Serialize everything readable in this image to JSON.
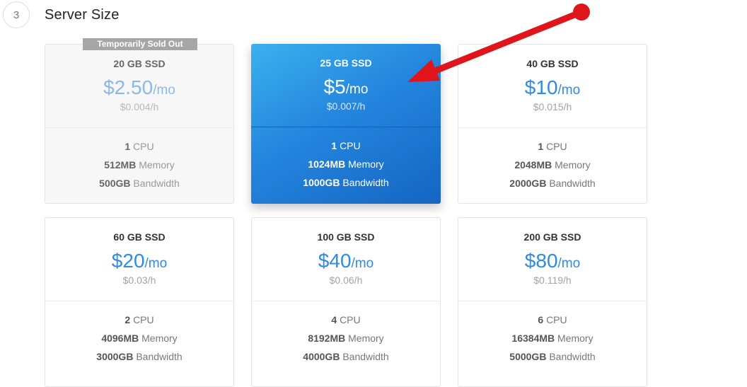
{
  "section": {
    "step": "3",
    "title": "Server Size"
  },
  "sold_badge": "Temporarily Sold Out",
  "plans": [
    {
      "name": "20 GB SSD",
      "price": "$2.50",
      "unit": "/mo",
      "hourly": "$0.004/h",
      "cpu": "1",
      "cpu_label": "CPU",
      "memory": "512MB",
      "memory_label": "Memory",
      "bandwidth": "500GB",
      "bandwidth_label": "Bandwidth",
      "sold_out": true
    },
    {
      "name": "25 GB SSD",
      "price": "$5",
      "unit": "/mo",
      "hourly": "$0.007/h",
      "cpu": "1",
      "cpu_label": "CPU",
      "memory": "1024MB",
      "memory_label": "Memory",
      "bandwidth": "1000GB",
      "bandwidth_label": "Bandwidth",
      "selected": true
    },
    {
      "name": "40 GB SSD",
      "price": "$10",
      "unit": "/mo",
      "hourly": "$0.015/h",
      "cpu": "1",
      "cpu_label": "CPU",
      "memory": "2048MB",
      "memory_label": "Memory",
      "bandwidth": "2000GB",
      "bandwidth_label": "Bandwidth"
    },
    {
      "name": "60 GB SSD",
      "price": "$20",
      "unit": "/mo",
      "hourly": "$0.03/h",
      "cpu": "2",
      "cpu_label": "CPU",
      "memory": "4096MB",
      "memory_label": "Memory",
      "bandwidth": "3000GB",
      "bandwidth_label": "Bandwidth"
    },
    {
      "name": "100 GB SSD",
      "price": "$40",
      "unit": "/mo",
      "hourly": "$0.06/h",
      "cpu": "4",
      "cpu_label": "CPU",
      "memory": "8192MB",
      "memory_label": "Memory",
      "bandwidth": "4000GB",
      "bandwidth_label": "Bandwidth"
    },
    {
      "name": "200 GB SSD",
      "price": "$80",
      "unit": "/mo",
      "hourly": "$0.119/h",
      "cpu": "6",
      "cpu_label": "CPU",
      "memory": "16384MB",
      "memory_label": "Memory",
      "bandwidth": "5000GB",
      "bandwidth_label": "Bandwidth"
    }
  ],
  "colors": {
    "accent": "#2e8ae6",
    "selected_bg": "#2486de",
    "annotation_arrow": "#e0141b"
  },
  "annotation": {
    "icon": "red-arrow-icon"
  }
}
